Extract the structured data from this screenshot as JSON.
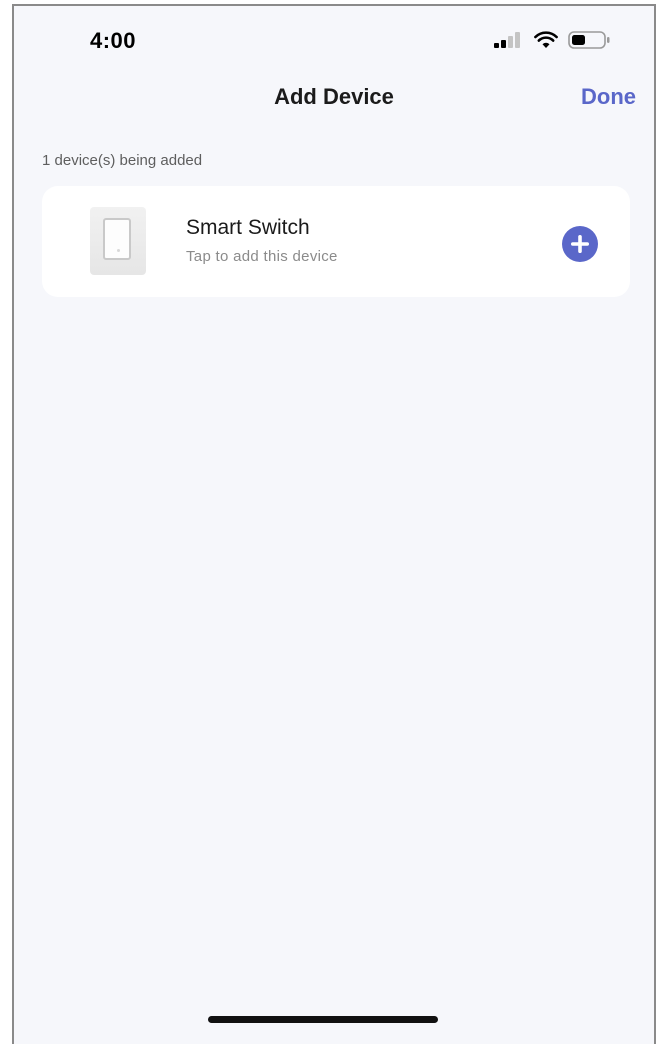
{
  "status_bar": {
    "time": "4:00",
    "icons": [
      "signal-icon",
      "wifi-icon",
      "battery-icon"
    ]
  },
  "nav": {
    "title": "Add Device",
    "done_label": "Done"
  },
  "section": {
    "label": "1 device(s) being added"
  },
  "devices": [
    {
      "name": "Smart Switch",
      "subtitle": "Tap to add this device",
      "icon": "smart-switch-image",
      "action_icon": "plus-icon"
    }
  ],
  "colors": {
    "accent": "#5a67c9",
    "background": "#f6f7fb",
    "card": "#ffffff",
    "primary_text": "#1b1b1b",
    "secondary_text": "#8b8b8b"
  }
}
